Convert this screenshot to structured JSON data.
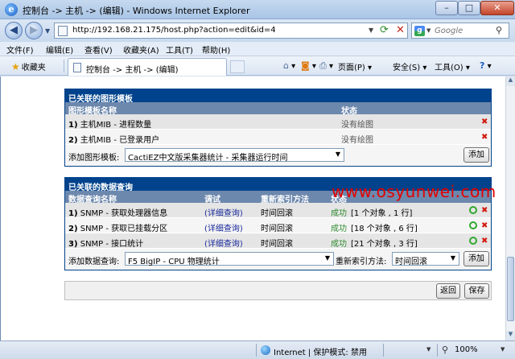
{
  "window": {
    "title": "控制台 -> 主机 -> (编辑) - Windows Internet Explorer",
    "controls": {
      "minimize": "–",
      "maximize": "□",
      "close": "✕"
    }
  },
  "address": {
    "url": "http://192.168.21.175/host.php?action=edit&id=4",
    "search_placeholder": "Google"
  },
  "menu": [
    "文件(F)",
    "编辑(E)",
    "查看(V)",
    "收藏夹(A)",
    "工具(T)",
    "帮助(H)"
  ],
  "favbar": {
    "favorites": "收藏夹",
    "tab_title": "控制台 -> 主机 -> (编辑)",
    "commands": {
      "page": "页面(P)",
      "safety": "安全(S)",
      "tools": "工具(O)",
      "help": "?"
    }
  },
  "graph_templates": {
    "header": "已关联的图形模板",
    "col_name": "图形模板名称",
    "col_status": "状态",
    "rows": [
      {
        "num": "1)",
        "name": "主机MIB - 进程数量",
        "status": "没有绘图"
      },
      {
        "num": "2)",
        "name": "主机MIB - 已登录用户",
        "status": "没有绘图"
      }
    ],
    "add_label": "添加图形模板:",
    "add_selected": "CactiEZ中文版采集器统计 - 采集器运行时间",
    "add_button": "添加"
  },
  "data_queries": {
    "header": "已关联的数据查询",
    "col_name": "数据查询名称",
    "col_debug": "调试",
    "col_reindex": "重新索引方法",
    "col_status": "状态",
    "rows": [
      {
        "num": "1)",
        "name": "SNMP - 获取处理器信息",
        "debug": "(详细查询)",
        "reindex": "时间回滚",
        "ok": "成功",
        "detail": "[1 个对象 , 1 行]"
      },
      {
        "num": "2)",
        "name": "SNMP - 获取已挂载分区",
        "debug": "(详细查询)",
        "reindex": "时间回滚",
        "ok": "成功",
        "detail": "[18 个对象 , 6 行]"
      },
      {
        "num": "3)",
        "name": "SNMP - 接口统计",
        "debug": "(详细查询)",
        "reindex": "时间回滚",
        "ok": "成功",
        "detail": "[21 个对象 , 3 行]"
      }
    ],
    "add_label": "添加数据查询:",
    "add_selected": "F5 BigIP - CPU 物理统计",
    "reindex_label": "重新索引方法:",
    "reindex_selected": "时间回滚",
    "add_button": "添加"
  },
  "footer": {
    "back": "返回",
    "save": "保存"
  },
  "status": {
    "zone": "Internet | 保护模式: 禁用",
    "zoom": "100%"
  },
  "watermark": "www.osyunwei.com"
}
